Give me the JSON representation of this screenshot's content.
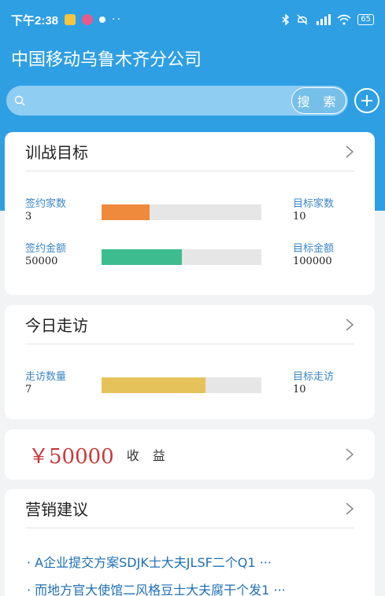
{
  "status_bar": {
    "time": "下午2:38",
    "more": "··",
    "battery": "65"
  },
  "app": {
    "title": "中国移动乌鲁木齐分公司"
  },
  "search": {
    "placeholder": "",
    "button_label": "搜 索"
  },
  "cards": {
    "training": {
      "title": "训战目标",
      "metrics": [
        {
          "left_label": "签约家数",
          "left_value": "3",
          "right_label": "目标家数",
          "right_value": "10",
          "progress": 0.3,
          "color": "#ef8a3d"
        },
        {
          "left_label": "签约金额",
          "left_value": "50000",
          "right_label": "目标金额",
          "right_value": "100000",
          "progress": 0.5,
          "color": "#3dbd8f"
        }
      ]
    },
    "visits": {
      "title": "今日走访",
      "metrics": [
        {
          "left_label": "走访数量",
          "left_value": "7",
          "right_label": "目标走访",
          "right_value": "10",
          "progress": 0.65,
          "color": "#e5c35a"
        }
      ]
    },
    "income": {
      "amount": "￥50000",
      "label": "收 益"
    },
    "marketing": {
      "title": "营销建议",
      "items": [
        "· A企业提交方案SDJK士大夫JLSF二个Q1 ···",
        "· 而地方官大使馆二风格豆士大夫腐干个发1 ···"
      ]
    }
  }
}
